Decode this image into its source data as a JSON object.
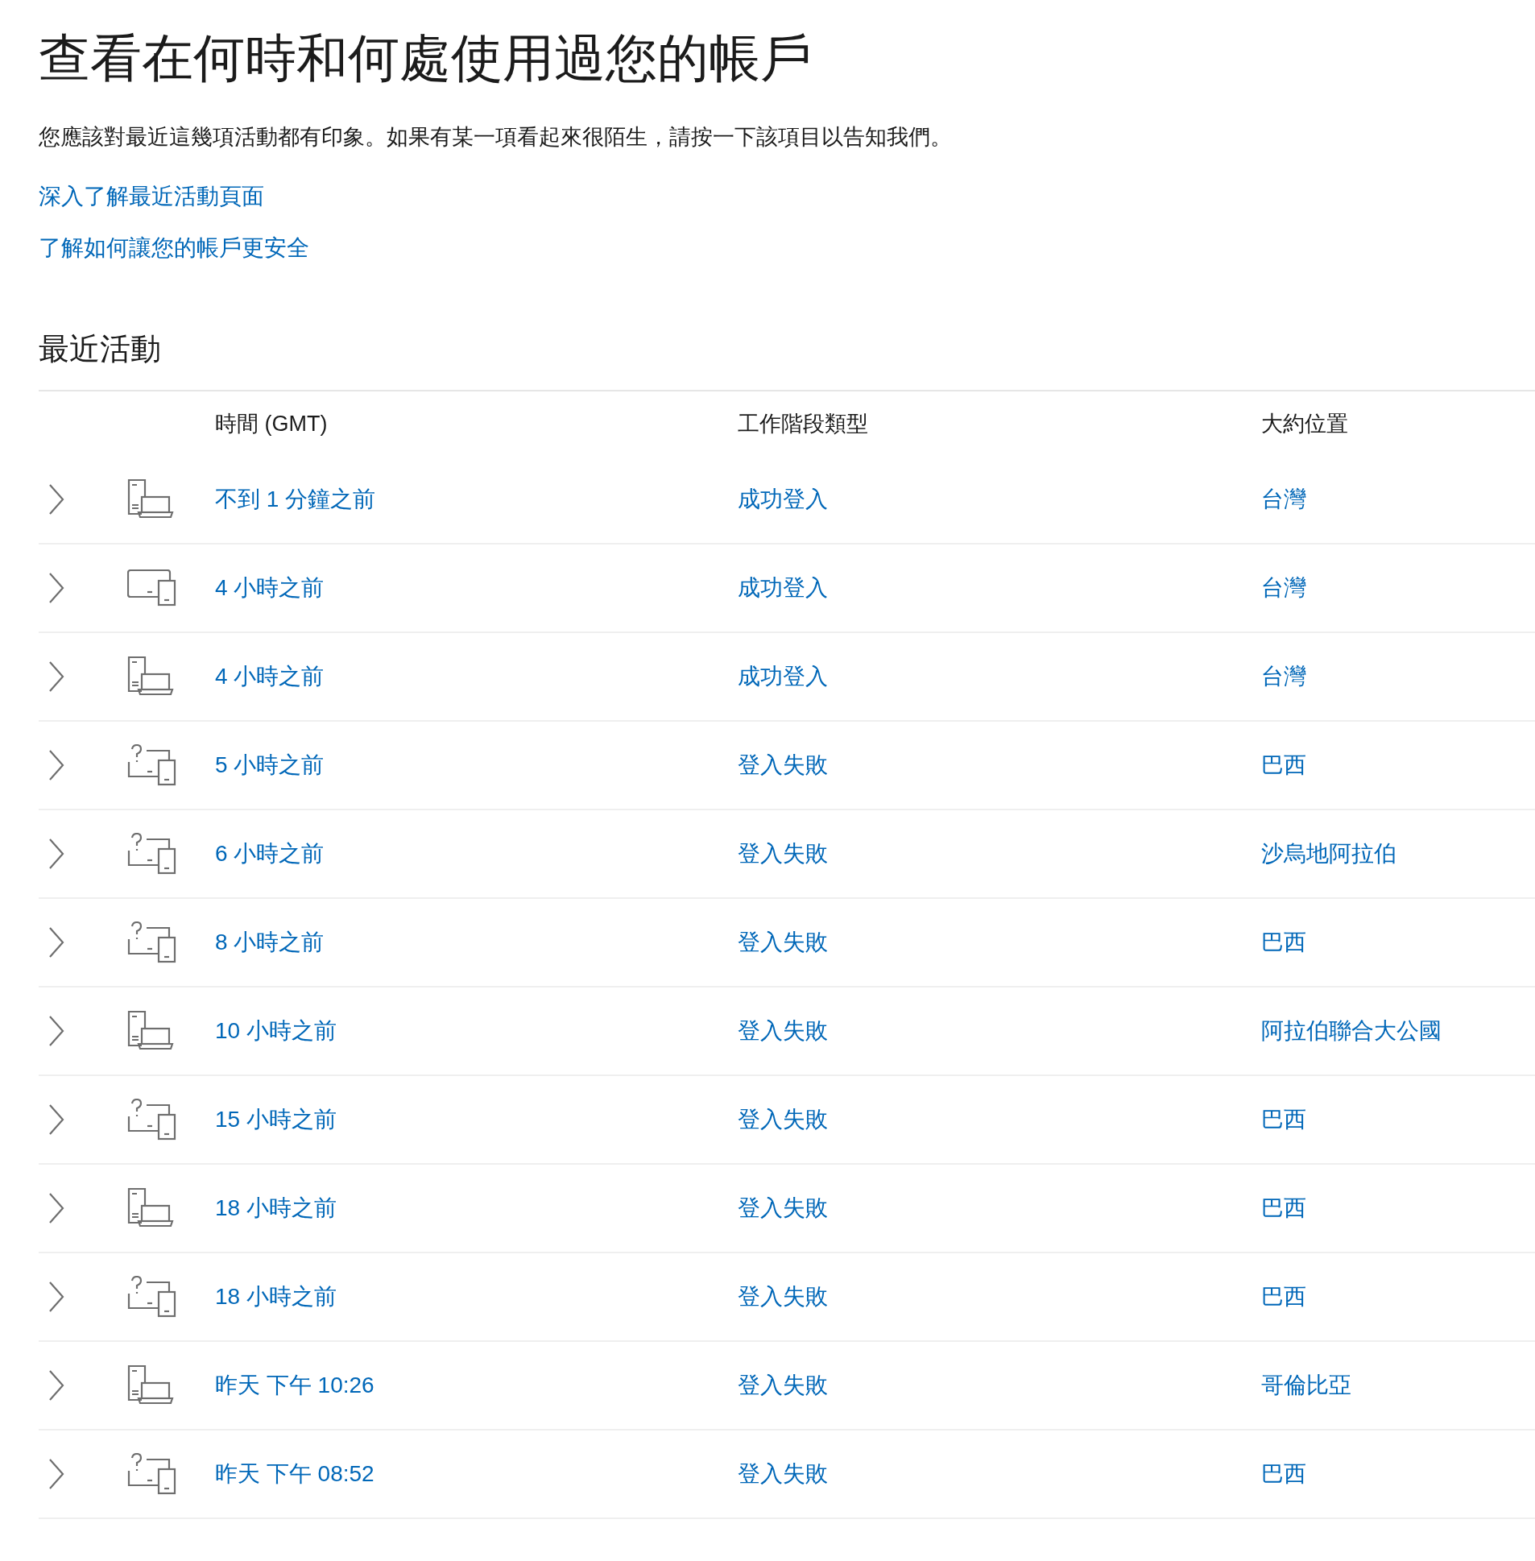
{
  "title": "查看在何時和何處使用過您的帳戶",
  "intro": "您應該對最近這幾項活動都有印象。如果有某一項看起來很陌生，請按一下該項目以告知我們。",
  "links": [
    "深入了解最近活動頁面",
    "了解如何讓您的帳戶更安全"
  ],
  "section_title": "最近活動",
  "table": {
    "columns": [
      "時間 (GMT)",
      "工作階段類型",
      "大約位置"
    ],
    "rows": [
      {
        "kind": "computer",
        "expanded": false,
        "time": "不到 1 分鐘之前",
        "type": "成功登入",
        "location": "台灣"
      },
      {
        "kind": "tablet",
        "expanded": false,
        "time": "4 小時之前",
        "type": "成功登入",
        "location": "台灣"
      },
      {
        "kind": "computer",
        "expanded": false,
        "time": "4 小時之前",
        "type": "成功登入",
        "location": "台灣"
      },
      {
        "kind": "unknown",
        "expanded": false,
        "time": "5 小時之前",
        "type": "登入失敗",
        "location": "巴西"
      },
      {
        "kind": "unknown",
        "expanded": false,
        "time": "6 小時之前",
        "type": "登入失敗",
        "location": "沙烏地阿拉伯"
      },
      {
        "kind": "unknown",
        "expanded": false,
        "time": "8 小時之前",
        "type": "登入失敗",
        "location": "巴西"
      },
      {
        "kind": "computer",
        "expanded": false,
        "time": "10 小時之前",
        "type": "登入失敗",
        "location": "阿拉伯聯合大公國"
      },
      {
        "kind": "unknown",
        "expanded": false,
        "time": "15 小時之前",
        "type": "登入失敗",
        "location": "巴西"
      },
      {
        "kind": "computer",
        "expanded": false,
        "time": "18 小時之前",
        "type": "登入失敗",
        "location": "巴西"
      },
      {
        "kind": "unknown",
        "expanded": false,
        "time": "18 小時之前",
        "type": "登入失敗",
        "location": "巴西"
      },
      {
        "kind": "computer",
        "expanded": false,
        "time": "昨天 下午 10:26",
        "type": "登入失敗",
        "location": "哥倫比亞"
      },
      {
        "kind": "unknown",
        "expanded": false,
        "time": "昨天 下午 08:52",
        "type": "登入失敗",
        "location": "巴西"
      }
    ]
  }
}
